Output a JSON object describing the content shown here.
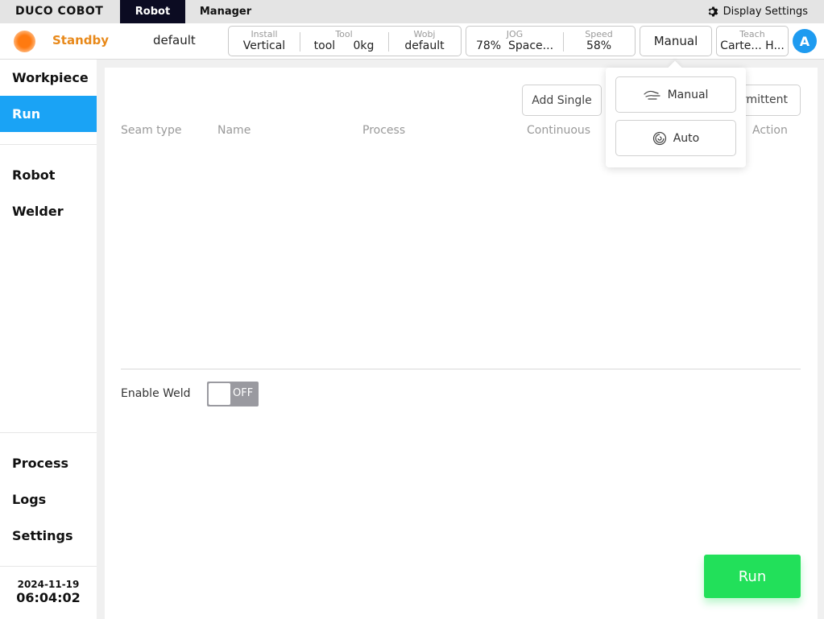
{
  "topbar": {
    "logo": "DUCO COBOT",
    "tabs": [
      {
        "label": "Robot"
      },
      {
        "label": "Manager"
      }
    ],
    "display_settings": "Display Settings"
  },
  "status": {
    "state": "Standby",
    "program": "default",
    "install": {
      "label": "Install",
      "value": "Vertical"
    },
    "tool": {
      "label": "Tool",
      "name": "tool",
      "weight": "0kg"
    },
    "wobj": {
      "label": "Wobj",
      "value": "default"
    },
    "jog": {
      "label": "JOG",
      "value": "78%",
      "space": "Space..."
    },
    "speed": {
      "label": "Speed",
      "value": "58%"
    },
    "mode": "Manual",
    "teach": {
      "label": "Teach",
      "value": "Carte... H..."
    },
    "avatar": "A"
  },
  "sidebar": {
    "items": [
      {
        "label": "Workpiece"
      },
      {
        "label": "Run"
      },
      {
        "label": "Robot"
      },
      {
        "label": "Welder"
      },
      {
        "label": "Process"
      },
      {
        "label": "Logs"
      },
      {
        "label": "Settings"
      }
    ],
    "date": "2024-11-19",
    "time": "06:04:02"
  },
  "main": {
    "add_single": "Add Single",
    "intermittent": "Intermittent",
    "columns": [
      "Seam type",
      "Name",
      "Process",
      "Continuous",
      "Action"
    ],
    "enable_weld": "Enable Weld",
    "toggle_state": "OFF",
    "run": "Run"
  },
  "mode_menu": {
    "items": [
      {
        "label": "Manual",
        "icon": "hand-icon"
      },
      {
        "label": "Auto",
        "icon": "auto-icon"
      }
    ]
  }
}
